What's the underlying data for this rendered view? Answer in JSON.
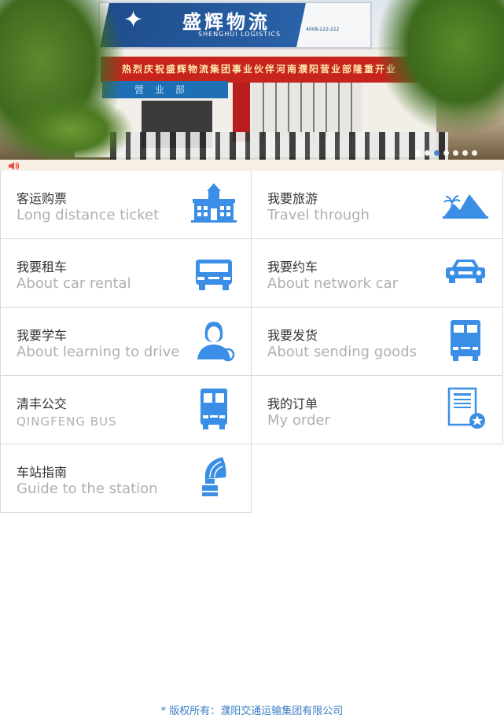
{
  "banner": {
    "sign_title": "盛辉物流",
    "sign_subtitle": "SHENGHUI LOGISTICS",
    "sign_phone": "4008-222-222",
    "sign_web": "www.shenghuilh.com",
    "red_banner_text": "热烈庆祝盛辉物流集团事业伙伴河南濮阳营业部隆重开业",
    "branch_sign": "营业部",
    "slide_count": 7,
    "active_slide": 3
  },
  "notice": {
    "icon": "speaker-icon"
  },
  "menu": [
    {
      "title": "客运购票",
      "subtitle": "Long distance ticket",
      "icon": "station-building-icon"
    },
    {
      "title": "我要旅游",
      "subtitle": "Travel through",
      "icon": "mountain-palm-icon"
    },
    {
      "title": "我要租车",
      "subtitle": "About car rental",
      "icon": "truck-front-icon"
    },
    {
      "title": "我要约车",
      "subtitle": "About network car",
      "icon": "car-front-icon"
    },
    {
      "title": "我要学车",
      "subtitle": "About learning to drive",
      "icon": "driver-woman-icon"
    },
    {
      "title": "我要发货",
      "subtitle": "About sending goods",
      "icon": "delivery-truck-icon"
    },
    {
      "title": "清丰公交",
      "subtitle": "QINGFENG  BUS",
      "icon": "bus-front-icon"
    },
    {
      "title": "我的订单",
      "subtitle": "My order",
      "icon": "order-document-icon"
    },
    {
      "title": "车站指南",
      "subtitle": "Guide to the station",
      "icon": "gramophone-guide-icon"
    }
  ],
  "footer": {
    "text": "* 版权所有：濮阳交通运输集团有限公司"
  },
  "colors": {
    "accent": "#3a8ee6",
    "title_text": "#333333",
    "subtitle_text": "#b0b0b0",
    "footer_text": "#3a7cc6",
    "notice_bg": "#f7efe3"
  }
}
